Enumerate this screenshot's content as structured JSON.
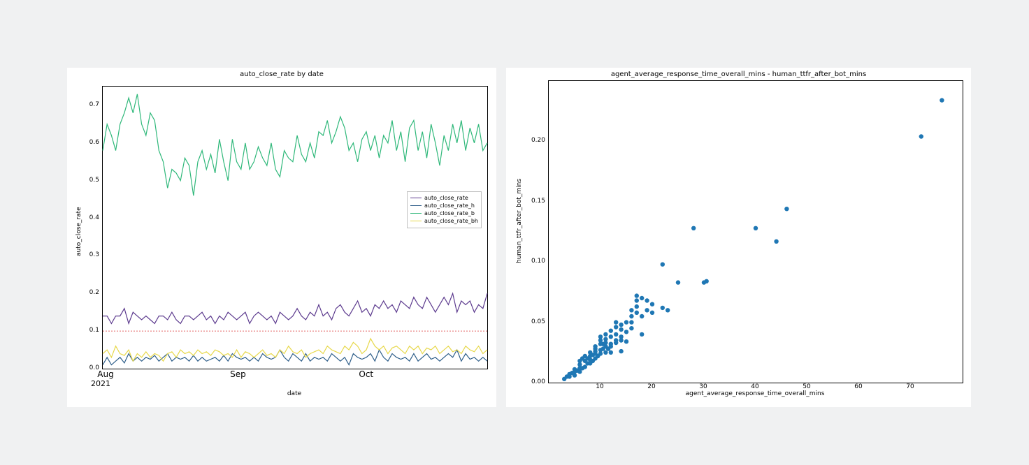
{
  "chart_data": [
    {
      "type": "line",
      "title": "auto_close_rate by date",
      "xlabel": "date",
      "ylabel": "auto_close_rate",
      "ylim": [
        0,
        0.75
      ],
      "x_ticks": [
        "Aug",
        "Sep",
        "Oct"
      ],
      "x_ticks2": "2021",
      "y_ticks": [
        "0.0",
        "0.1",
        "0.2",
        "0.3",
        "0.4",
        "0.5",
        "0.6",
        "0.7"
      ],
      "reference_line": 0.1,
      "series": [
        {
          "name": "auto_close_rate",
          "color": "#5c3a8e",
          "values": [
            0.14,
            0.14,
            0.12,
            0.14,
            0.14,
            0.16,
            0.12,
            0.15,
            0.14,
            0.13,
            0.14,
            0.13,
            0.12,
            0.14,
            0.14,
            0.13,
            0.15,
            0.13,
            0.12,
            0.14,
            0.14,
            0.13,
            0.14,
            0.15,
            0.13,
            0.14,
            0.12,
            0.14,
            0.13,
            0.15,
            0.14,
            0.13,
            0.14,
            0.15,
            0.12,
            0.14,
            0.15,
            0.14,
            0.13,
            0.14,
            0.12,
            0.15,
            0.14,
            0.13,
            0.14,
            0.16,
            0.14,
            0.13,
            0.15,
            0.14,
            0.17,
            0.14,
            0.15,
            0.13,
            0.16,
            0.17,
            0.15,
            0.14,
            0.16,
            0.18,
            0.15,
            0.16,
            0.14,
            0.17,
            0.16,
            0.18,
            0.16,
            0.17,
            0.15,
            0.18,
            0.17,
            0.16,
            0.19,
            0.17,
            0.16,
            0.19,
            0.17,
            0.15,
            0.17,
            0.19,
            0.17,
            0.2,
            0.15,
            0.18,
            0.17,
            0.18,
            0.15,
            0.17,
            0.16,
            0.2
          ]
        },
        {
          "name": "auto_close_rate_h",
          "color": "#2f5f8a",
          "values": [
            0.01,
            0.03,
            0.01,
            0.02,
            0.03,
            0.015,
            0.04,
            0.02,
            0.03,
            0.02,
            0.03,
            0.025,
            0.035,
            0.02,
            0.03,
            0.04,
            0.02,
            0.03,
            0.025,
            0.03,
            0.02,
            0.035,
            0.02,
            0.03,
            0.02,
            0.025,
            0.03,
            0.02,
            0.035,
            0.02,
            0.04,
            0.03,
            0.025,
            0.03,
            0.02,
            0.03,
            0.02,
            0.04,
            0.03,
            0.025,
            0.03,
            0.05,
            0.03,
            0.02,
            0.04,
            0.03,
            0.02,
            0.04,
            0.02,
            0.03,
            0.025,
            0.03,
            0.02,
            0.04,
            0.03,
            0.02,
            0.03,
            0.01,
            0.04,
            0.03,
            0.025,
            0.03,
            0.04,
            0.02,
            0.05,
            0.03,
            0.02,
            0.04,
            0.03,
            0.025,
            0.03,
            0.02,
            0.04,
            0.02,
            0.03,
            0.04,
            0.025,
            0.03,
            0.02,
            0.03,
            0.04,
            0.03,
            0.05,
            0.02,
            0.04,
            0.025,
            0.03,
            0.02,
            0.03,
            0.02
          ]
        },
        {
          "name": "auto_close_rate_b",
          "color": "#2fb87a",
          "values": [
            0.58,
            0.65,
            0.62,
            0.58,
            0.65,
            0.68,
            0.72,
            0.68,
            0.73,
            0.65,
            0.62,
            0.68,
            0.66,
            0.58,
            0.55,
            0.48,
            0.53,
            0.52,
            0.5,
            0.56,
            0.54,
            0.46,
            0.55,
            0.58,
            0.53,
            0.57,
            0.52,
            0.61,
            0.55,
            0.5,
            0.61,
            0.55,
            0.53,
            0.6,
            0.53,
            0.55,
            0.59,
            0.56,
            0.54,
            0.6,
            0.53,
            0.51,
            0.58,
            0.56,
            0.55,
            0.62,
            0.57,
            0.55,
            0.6,
            0.56,
            0.63,
            0.62,
            0.66,
            0.6,
            0.63,
            0.67,
            0.64,
            0.58,
            0.6,
            0.55,
            0.61,
            0.63,
            0.58,
            0.62,
            0.56,
            0.62,
            0.6,
            0.66,
            0.58,
            0.63,
            0.55,
            0.64,
            0.66,
            0.58,
            0.63,
            0.56,
            0.65,
            0.6,
            0.54,
            0.62,
            0.58,
            0.65,
            0.6,
            0.66,
            0.58,
            0.64,
            0.6,
            0.65,
            0.58,
            0.6
          ]
        },
        {
          "name": "auto_close_rate_bh",
          "color": "#e7d84a",
          "values": [
            0.04,
            0.05,
            0.03,
            0.06,
            0.04,
            0.035,
            0.05,
            0.02,
            0.04,
            0.03,
            0.045,
            0.03,
            0.04,
            0.035,
            0.02,
            0.04,
            0.045,
            0.03,
            0.05,
            0.04,
            0.045,
            0.035,
            0.05,
            0.04,
            0.045,
            0.035,
            0.05,
            0.045,
            0.035,
            0.04,
            0.03,
            0.05,
            0.03,
            0.045,
            0.04,
            0.03,
            0.04,
            0.05,
            0.035,
            0.04,
            0.03,
            0.05,
            0.04,
            0.06,
            0.045,
            0.04,
            0.05,
            0.03,
            0.04,
            0.045,
            0.05,
            0.04,
            0.06,
            0.05,
            0.045,
            0.04,
            0.06,
            0.05,
            0.07,
            0.06,
            0.04,
            0.05,
            0.08,
            0.06,
            0.05,
            0.06,
            0.04,
            0.055,
            0.06,
            0.05,
            0.04,
            0.06,
            0.05,
            0.06,
            0.04,
            0.055,
            0.05,
            0.06,
            0.04,
            0.05,
            0.06,
            0.045,
            0.05,
            0.04,
            0.06,
            0.05,
            0.045,
            0.06,
            0.04,
            0.05
          ]
        }
      ]
    },
    {
      "type": "scatter",
      "title": "agent_average_response_time_overall_mins - human_ttfr_after_bot_mins",
      "xlabel": "agent_average_response_time_overall_mins",
      "ylabel": "human_ttfr_after_bot_mins",
      "xlim": [
        0,
        80
      ],
      "ylim": [
        0,
        0.25
      ],
      "x_ticks": [
        "10",
        "20",
        "30",
        "40",
        "50",
        "60",
        "70"
      ],
      "y_ticks": [
        "0.00",
        "0.05",
        "0.10",
        "0.15",
        "0.20"
      ],
      "points": [
        [
          3,
          0.003
        ],
        [
          3.5,
          0.005
        ],
        [
          4,
          0.005
        ],
        [
          4,
          0.007
        ],
        [
          4.5,
          0.008
        ],
        [
          5,
          0.006
        ],
        [
          5,
          0.011
        ],
        [
          5,
          0.009
        ],
        [
          5.5,
          0.01
        ],
        [
          6,
          0.009
        ],
        [
          6,
          0.012
        ],
        [
          6,
          0.015
        ],
        [
          6,
          0.018
        ],
        [
          6.5,
          0.012
        ],
        [
          6.5,
          0.02
        ],
        [
          7,
          0.013
        ],
        [
          7,
          0.022
        ],
        [
          7,
          0.018
        ],
        [
          7.5,
          0.016
        ],
        [
          7.5,
          0.02
        ],
        [
          8,
          0.016
        ],
        [
          8,
          0.022
        ],
        [
          8,
          0.019
        ],
        [
          8,
          0.025
        ],
        [
          8.5,
          0.018
        ],
        [
          8.5,
          0.023
        ],
        [
          9,
          0.02
        ],
        [
          9,
          0.024
        ],
        [
          9,
          0.028
        ],
        [
          9,
          0.03
        ],
        [
          9,
          0.026
        ],
        [
          9.5,
          0.022
        ],
        [
          10,
          0.024
        ],
        [
          10,
          0.027
        ],
        [
          10,
          0.032
        ],
        [
          10,
          0.035
        ],
        [
          10,
          0.038
        ],
        [
          10.5,
          0.028
        ],
        [
          10.5,
          0.032
        ],
        [
          11,
          0.025
        ],
        [
          11,
          0.03
        ],
        [
          11,
          0.036
        ],
        [
          11,
          0.04
        ],
        [
          11,
          0.033
        ],
        [
          11.5,
          0.028
        ],
        [
          12,
          0.032
        ],
        [
          12,
          0.038
        ],
        [
          12,
          0.043
        ],
        [
          12,
          0.03
        ],
        [
          12,
          0.025
        ],
        [
          13,
          0.035
        ],
        [
          13,
          0.04
        ],
        [
          13,
          0.033
        ],
        [
          13,
          0.046
        ],
        [
          13,
          0.05
        ],
        [
          14,
          0.038
        ],
        [
          14,
          0.044
        ],
        [
          14,
          0.035
        ],
        [
          14,
          0.026
        ],
        [
          14,
          0.048
        ],
        [
          15,
          0.042
        ],
        [
          15,
          0.05
        ],
        [
          15,
          0.034
        ],
        [
          16,
          0.045
        ],
        [
          16,
          0.055
        ],
        [
          16,
          0.06
        ],
        [
          16,
          0.05
        ],
        [
          17,
          0.058
        ],
        [
          17,
          0.063
        ],
        [
          17,
          0.068
        ],
        [
          17,
          0.072
        ],
        [
          18,
          0.055
        ],
        [
          18,
          0.04
        ],
        [
          18,
          0.07
        ],
        [
          19,
          0.06
        ],
        [
          19,
          0.068
        ],
        [
          20,
          0.058
        ],
        [
          20,
          0.065
        ],
        [
          22,
          0.098
        ],
        [
          22,
          0.062
        ],
        [
          23,
          0.06
        ],
        [
          25,
          0.083
        ],
        [
          28,
          0.128
        ],
        [
          30,
          0.083
        ],
        [
          30.5,
          0.084
        ],
        [
          40,
          0.128
        ],
        [
          44,
          0.117
        ],
        [
          46,
          0.144
        ],
        [
          72,
          0.204
        ],
        [
          76,
          0.234
        ]
      ]
    }
  ]
}
